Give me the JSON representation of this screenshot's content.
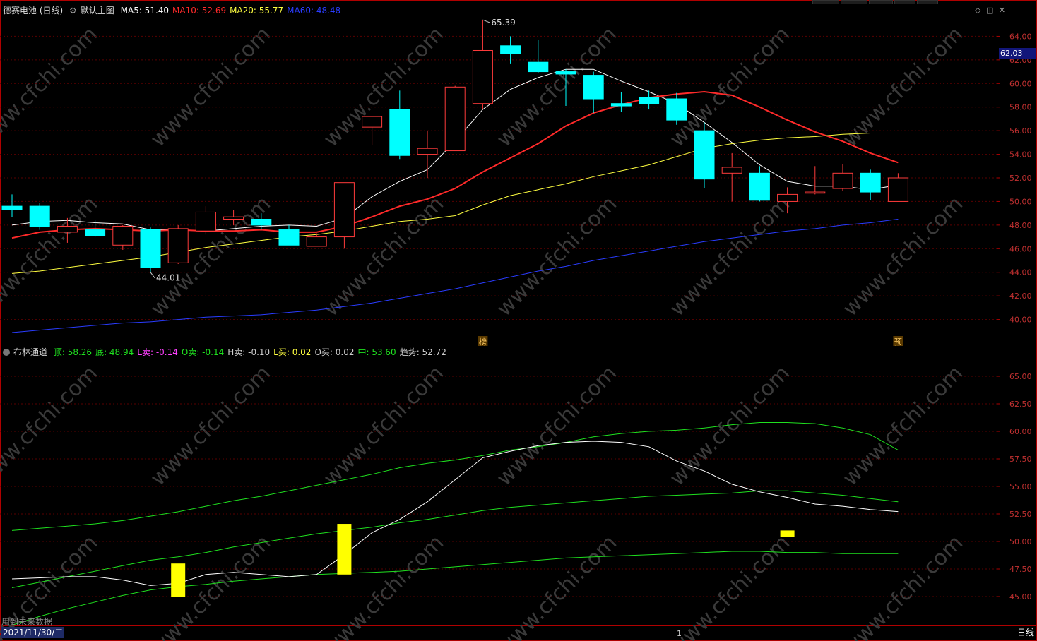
{
  "main_panel": {
    "title": "德赛电池 (日线)",
    "indicator_name": "默认主图",
    "ma_labels": [
      {
        "label": "MA5: 51.40",
        "color": "#ffffff"
      },
      {
        "label": "MA10: 52.69",
        "color": "#ff2a2a"
      },
      {
        "label": "MA20: 55.77",
        "color": "#ffff40"
      },
      {
        "label": "MA60: 48.48",
        "color": "#2a3cff"
      }
    ],
    "current_price_tag": "62.03",
    "high_annotation": "65.39",
    "low_annotation": "44.01",
    "markers": [
      "榜",
      "预"
    ]
  },
  "sub_panel": {
    "indicator_name": "布林通道",
    "values": [
      {
        "label": "顶: 58.26",
        "color": "#1fe01f"
      },
      {
        "label": "底: 48.94",
        "color": "#1fe01f"
      },
      {
        "label": "L卖: -0.14",
        "color": "#ff40ff"
      },
      {
        "label": "O卖: -0.14",
        "color": "#1fe01f"
      },
      {
        "label": "H卖: -0.10",
        "color": "#cccccc"
      },
      {
        "label": "L买: 0.02",
        "color": "#ffff40"
      },
      {
        "label": "O买: 0.02",
        "color": "#cccccc"
      },
      {
        "label": "中: 53.60",
        "color": "#1fe01f"
      },
      {
        "label": "趋势: 52.72",
        "color": "#cccccc"
      }
    ]
  },
  "footer": {
    "date": "2021/11/30/二",
    "period": "日线",
    "note": "用到未来数据",
    "cursor_mark": "1"
  },
  "watermark": "www.cfchi.com",
  "colors": {
    "up": "#ff3b3b",
    "down": "#00ffff",
    "grid": "#5a0000",
    "axis": "#b00000"
  },
  "chart_data": [
    {
      "type": "candlestick",
      "title": "德赛电池 (日线)",
      "ylim": [
        38,
        66
      ],
      "y_ticks": [
        40,
        42,
        44,
        46,
        48,
        50,
        52,
        54,
        56,
        58,
        60,
        62,
        64
      ],
      "candles": [
        {
          "o": 49.6,
          "h": 50.6,
          "l": 48.7,
          "c": 49.3
        },
        {
          "o": 49.6,
          "h": 49.9,
          "l": 47.6,
          "c": 47.9
        },
        {
          "o": 47.4,
          "h": 48.6,
          "l": 46.5,
          "c": 47.9
        },
        {
          "o": 47.6,
          "h": 48.4,
          "l": 47.0,
          "c": 47.1
        },
        {
          "o": 46.3,
          "h": 48.0,
          "l": 45.9,
          "c": 47.9
        },
        {
          "o": 47.6,
          "h": 47.8,
          "l": 44.0,
          "c": 44.4
        },
        {
          "o": 44.8,
          "h": 48.0,
          "l": 44.7,
          "c": 47.7
        },
        {
          "o": 47.5,
          "h": 49.6,
          "l": 47.2,
          "c": 49.1
        },
        {
          "o": 48.5,
          "h": 49.3,
          "l": 48.0,
          "c": 48.7
        },
        {
          "o": 48.5,
          "h": 49.0,
          "l": 47.6,
          "c": 48.0
        },
        {
          "o": 47.6,
          "h": 48.0,
          "l": 46.3,
          "c": 46.3
        },
        {
          "o": 46.2,
          "h": 47.3,
          "l": 46.2,
          "c": 47.0
        },
        {
          "o": 47.0,
          "h": 51.6,
          "l": 46.0,
          "c": 51.6
        },
        {
          "o": 56.3,
          "h": 57.0,
          "l": 54.8,
          "c": 57.2
        },
        {
          "o": 57.8,
          "h": 59.4,
          "l": 53.6,
          "c": 53.9
        },
        {
          "o": 54.0,
          "h": 56.0,
          "l": 52.0,
          "c": 54.5
        },
        {
          "o": 54.3,
          "h": 59.8,
          "l": 54.3,
          "c": 59.7
        },
        {
          "o": 58.3,
          "h": 65.4,
          "l": 57.8,
          "c": 62.8
        },
        {
          "o": 63.2,
          "h": 64.0,
          "l": 61.7,
          "c": 62.5
        },
        {
          "o": 61.8,
          "h": 63.7,
          "l": 60.9,
          "c": 61.0
        },
        {
          "o": 61.0,
          "h": 61.2,
          "l": 58.1,
          "c": 60.8
        },
        {
          "o": 60.7,
          "h": 61.0,
          "l": 57.5,
          "c": 58.7
        },
        {
          "o": 58.3,
          "h": 59.3,
          "l": 57.6,
          "c": 58.1
        },
        {
          "o": 58.8,
          "h": 59.4,
          "l": 57.8,
          "c": 58.3
        },
        {
          "o": 58.7,
          "h": 59.2,
          "l": 56.5,
          "c": 56.9
        },
        {
          "o": 56.0,
          "h": 56.7,
          "l": 51.1,
          "c": 51.9
        },
        {
          "o": 52.4,
          "h": 54.1,
          "l": 50.0,
          "c": 52.9
        },
        {
          "o": 52.4,
          "h": 53.0,
          "l": 50.0,
          "c": 50.1
        },
        {
          "o": 50.0,
          "h": 51.2,
          "l": 49.0,
          "c": 50.6
        },
        {
          "o": 50.7,
          "h": 53.0,
          "l": 50.6,
          "c": 50.8
        },
        {
          "o": 51.1,
          "h": 53.2,
          "l": 50.9,
          "c": 52.4
        },
        {
          "o": 52.4,
          "h": 52.7,
          "l": 50.1,
          "c": 50.8
        },
        {
          "o": 50.0,
          "h": 52.4,
          "l": 50.0,
          "c": 52.0
        }
      ],
      "series": [
        {
          "name": "MA5",
          "color": "#ffffff",
          "values": [
            48.0,
            48.3,
            48.4,
            48.2,
            48.1,
            47.6,
            47.6,
            47.5,
            47.7,
            47.9,
            48.0,
            47.9,
            48.6,
            50.4,
            51.7,
            52.7,
            55.1,
            57.8,
            59.5,
            60.5,
            61.2,
            61.2,
            60.2,
            59.3,
            58.3,
            56.7,
            55.0,
            53.1,
            51.7,
            51.3,
            51.3,
            51.0,
            51.4
          ]
        },
        {
          "name": "MA10",
          "color": "#ff2a2a",
          "values": [
            46.9,
            47.4,
            47.6,
            47.7,
            47.6,
            47.5,
            47.6,
            47.5,
            47.5,
            47.6,
            47.4,
            47.4,
            47.9,
            48.7,
            49.6,
            50.2,
            51.1,
            52.5,
            53.7,
            54.9,
            56.4,
            57.5,
            58.2,
            58.8,
            59.1,
            59.3,
            59.0,
            58.0,
            56.9,
            55.9,
            55.1,
            54.1,
            53.3
          ]
        },
        {
          "name": "MA20",
          "color": "#ffff40",
          "values": [
            43.9,
            44.1,
            44.4,
            44.7,
            45.0,
            45.3,
            45.7,
            46.1,
            46.4,
            46.7,
            47.0,
            47.2,
            47.5,
            47.9,
            48.3,
            48.5,
            48.8,
            49.7,
            50.5,
            51.0,
            51.5,
            52.1,
            52.6,
            53.1,
            53.8,
            54.5,
            54.9,
            55.2,
            55.4,
            55.5,
            55.7,
            55.8,
            55.8
          ]
        },
        {
          "name": "MA60",
          "color": "#2a3cff",
          "values": [
            38.9,
            39.1,
            39.3,
            39.5,
            39.7,
            39.8,
            40.0,
            40.2,
            40.3,
            40.4,
            40.6,
            40.8,
            41.1,
            41.4,
            41.8,
            42.2,
            42.6,
            43.1,
            43.6,
            44.1,
            44.5,
            45.0,
            45.4,
            45.8,
            46.2,
            46.6,
            46.9,
            47.2,
            47.5,
            47.7,
            48.0,
            48.2,
            48.5
          ]
        }
      ]
    },
    {
      "type": "line",
      "title": "布林通道",
      "ylim": [
        42.5,
        67.5
      ],
      "y_ticks": [
        45.0,
        47.5,
        50.0,
        52.5,
        55.0,
        57.5,
        60.0,
        62.5,
        65.0
      ],
      "series": [
        {
          "name": "顶",
          "color": "#1fe01f",
          "values": [
            51.0,
            51.2,
            51.4,
            51.6,
            51.9,
            52.3,
            52.7,
            53.2,
            53.7,
            54.1,
            54.6,
            55.1,
            55.6,
            56.1,
            56.7,
            57.1,
            57.4,
            57.8,
            58.3,
            58.6,
            59.0,
            59.5,
            59.8,
            60.0,
            60.1,
            60.3,
            60.6,
            60.8,
            60.8,
            60.7,
            60.3,
            59.7,
            58.3
          ]
        },
        {
          "name": "中",
          "color": "#1fe01f",
          "values": [
            45.8,
            46.3,
            46.8,
            47.3,
            47.8,
            48.3,
            48.6,
            49.0,
            49.5,
            49.9,
            50.3,
            50.7,
            51.0,
            51.3,
            51.7,
            52.0,
            52.4,
            52.8,
            53.1,
            53.3,
            53.5,
            53.7,
            53.9,
            54.1,
            54.2,
            54.3,
            54.4,
            54.6,
            54.6,
            54.4,
            54.2,
            53.9,
            53.6
          ]
        },
        {
          "name": "底",
          "color": "#1fe01f",
          "values": [
            42.4,
            43.2,
            43.9,
            44.5,
            45.1,
            45.6,
            45.9,
            46.1,
            46.4,
            46.6,
            46.8,
            47.0,
            47.1,
            47.2,
            47.3,
            47.5,
            47.7,
            47.9,
            48.1,
            48.3,
            48.5,
            48.6,
            48.7,
            48.8,
            48.9,
            49.0,
            49.1,
            49.1,
            49.0,
            49.0,
            48.9,
            48.9,
            48.9
          ]
        },
        {
          "name": "趋势",
          "color": "#ffffff",
          "values": [
            46.6,
            46.7,
            46.8,
            46.8,
            46.5,
            46.0,
            46.2,
            47.0,
            47.2,
            47.0,
            46.8,
            47.0,
            48.8,
            50.8,
            52.0,
            53.6,
            55.6,
            57.6,
            58.2,
            58.7,
            59.0,
            59.1,
            59.0,
            58.6,
            57.3,
            56.4,
            55.2,
            54.5,
            54.0,
            53.4,
            53.2,
            52.9,
            52.72
          ]
        }
      ],
      "signals": [
        {
          "index": 6,
          "from": 45.0,
          "to": 48.0,
          "color": "#ffff00"
        },
        {
          "index": 12,
          "from": 47.0,
          "to": 51.6,
          "color": "#ffff00"
        },
        {
          "index": 28,
          "from": 50.4,
          "to": 51.0,
          "color": "#ffff00"
        }
      ]
    }
  ]
}
